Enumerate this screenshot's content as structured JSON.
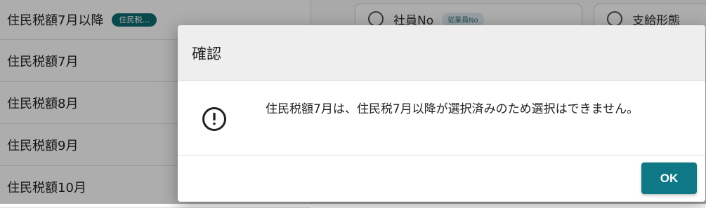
{
  "background": {
    "list_items": [
      {
        "label": "住民税額7月以降",
        "badge": "住民税..."
      },
      {
        "label": "住民税額7月"
      },
      {
        "label": "住民税額8月"
      },
      {
        "label": "住民税額9月"
      },
      {
        "label": "住民税額10月"
      }
    ],
    "cards": [
      {
        "label": "社員No",
        "chip": "従業員No"
      },
      {
        "label": "支給形態"
      }
    ]
  },
  "dialog": {
    "title": "確認",
    "message": "住民税額7月は、住民税7月以降が選択済みのため選択はできません。",
    "ok_label": "OK",
    "icon": "alert-circle-icon"
  },
  "colors": {
    "accent": "#0e7886",
    "badge": "#0e6a70"
  }
}
